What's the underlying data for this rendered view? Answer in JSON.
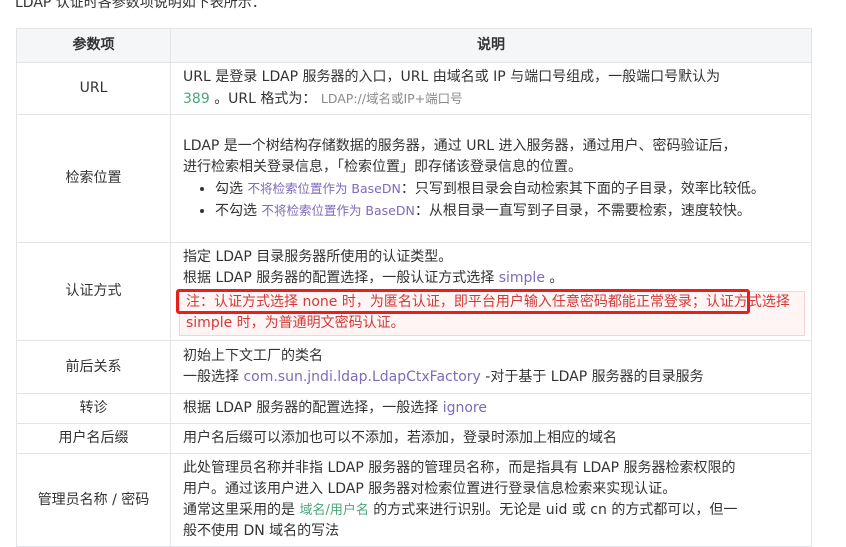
{
  "intro": "LDAP 认证时各参数项说明如下表所示：",
  "table": {
    "header_param": "参数项",
    "header_desc": "说明",
    "url": {
      "name": "URL",
      "line1": "URL 是登录 LDAP 服务器的入口，URL 由域名或 IP 与端口号组成，一般端口号默认为",
      "port": "389",
      "format_prefix": "。URL 格式为：",
      "format_value": "LDAP://域名或IP+端口号"
    },
    "search": {
      "name": "检索位置",
      "line1": "LDAP 是一个树结构存储数据的服务器，通过 URL 进入服务器，通过用户、密码验证后，",
      "line2": "进行检索相关登录信息，「检索位置」即存储该登录信息的位置。",
      "opt1_prefix": "勾选",
      "opt1_code": "不将检索位置作为 BaseDN",
      "opt1_text": "：只写到根目录会自动检索其下面的子目录，效率比较低。",
      "opt2_prefix": "不勾选",
      "opt2_code": "不将检索位置作为 BaseDN",
      "opt2_text": "：从根目录一直写到子目录，不需要检索，速度较快。"
    },
    "auth": {
      "name": "认证方式",
      "line1": "指定 LDAP 目录服务器所使用的认证类型。",
      "line2_prefix": "根据  LDAP 服务器的配置选择，一般认证方式选择",
      "line2_code": "simple",
      "line2_suffix": "。",
      "note_part1": "注：认证方式选择 none 时，为匿名认证，即平台用户输入任意密码都能正常登录；",
      "note_part2": "认证方式选择 simple 时，为普通明文密码认证。"
    },
    "context": {
      "name": "前后关系",
      "line1": "初始上下文工厂的类名",
      "line2_prefix": "一般选择",
      "line2_code": "com.sun.jndi.ldap.LdapCtxFactory",
      "line2_suffix": "-对于基于 LDAP 服务器的目录服务"
    },
    "referral": {
      "name": "转诊",
      "text_prefix": "根据  LDAP 服务器的配置选择，一般选择",
      "text_code": "ignore"
    },
    "suffix": {
      "name": "用户名后缀",
      "text": "用户名后缀可以添加也可以不添加，若添加，登录时添加上相应的域名"
    },
    "admin": {
      "name": "管理员名称 / 密码",
      "line1": "此处管理员名称并非指 LDAP 服务器的管理员名称，而是指具有 LDAP 服务器检索权限的",
      "line2": "用户。通过该用户进入 LDAP 服务器对检索位置进行登录信息检索来实现认证。",
      "line3_prefix": "通常这里采用的是",
      "line3_code": "域名/用户名",
      "line3_suffix": "的方式来进行识别。无论是 uid 或 cn 的方式都可以，但一",
      "line4": "般不使用 DN 域名的写法"
    }
  }
}
